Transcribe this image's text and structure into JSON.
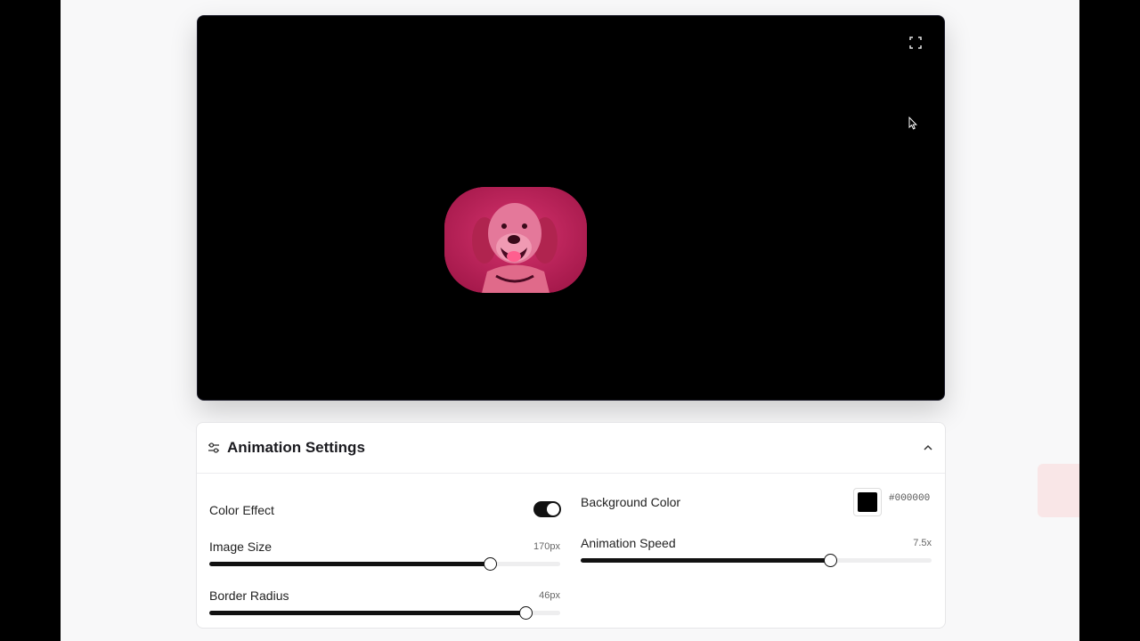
{
  "settings": {
    "title": "Animation Settings",
    "color_effect": {
      "label": "Color Effect",
      "enabled": true
    },
    "background_color": {
      "label": "Background Color",
      "value": "#000000"
    },
    "image_size": {
      "label": "Image Size",
      "value_text": "170px",
      "fraction": 0.8
    },
    "animation_speed": {
      "label": "Animation Speed",
      "value_text": "7.5x",
      "fraction": 0.71
    },
    "border_radius": {
      "label": "Border Radius",
      "value_text": "46px",
      "fraction": 0.9
    }
  },
  "icons": {
    "fullscreen": "fullscreen-icon",
    "settings": "sliders-icon",
    "collapse": "chevron-up-icon"
  },
  "colors": {
    "image_tint": "#c2185b",
    "preview_bg": "#000000",
    "accent": "#111111"
  }
}
